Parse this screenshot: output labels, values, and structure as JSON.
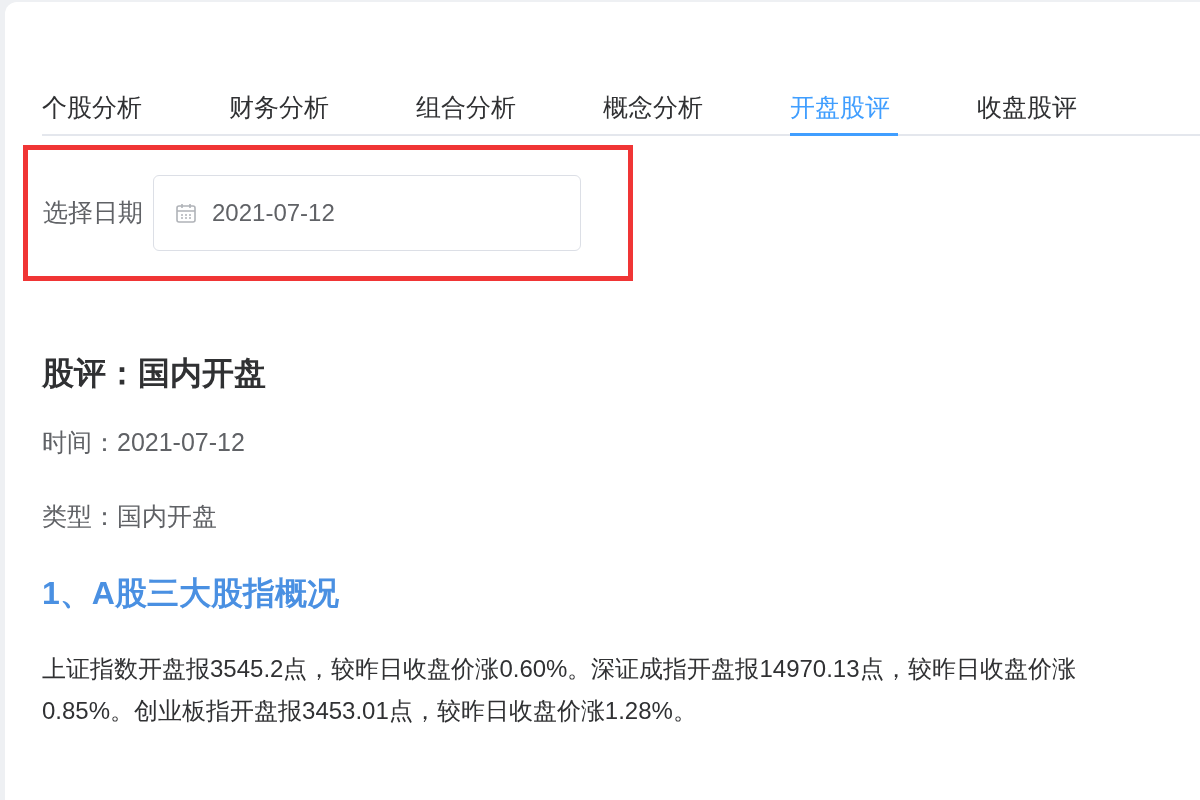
{
  "tabs": [
    {
      "label": "个股分析",
      "selected": false
    },
    {
      "label": "财务分析",
      "selected": false
    },
    {
      "label": "组合分析",
      "selected": false
    },
    {
      "label": "概念分析",
      "selected": false
    },
    {
      "label": "开盘股评",
      "selected": true
    },
    {
      "label": "收盘股评",
      "selected": false
    }
  ],
  "date_filter": {
    "label": "选择日期",
    "value": "2021-07-12",
    "highlighted": true
  },
  "article": {
    "title": "股评：国内开盘",
    "time": "时间：2021-07-12",
    "type": "类型：国内开盘",
    "section_heading": "1、A股三大股指概况",
    "paragraph": "上证指数开盘报3545.2点，较昨日收盘价涨0.60%。深证成指开盘报14970.13点，较昨日收盘价涨0.85%。创业板指开盘报3453.01点，较昨日收盘价涨1.28%。"
  }
}
